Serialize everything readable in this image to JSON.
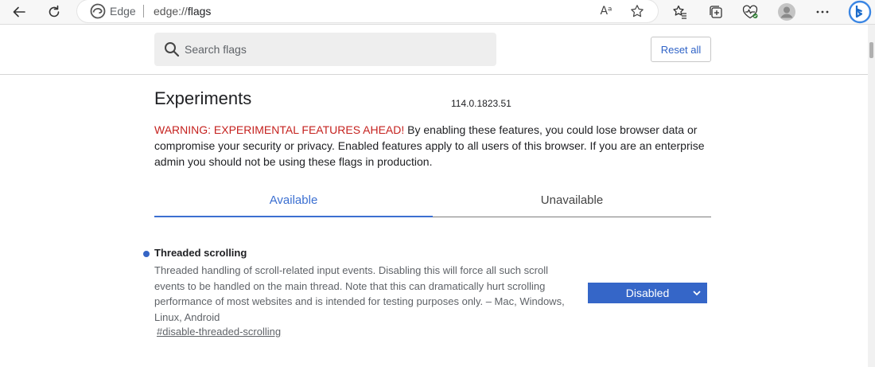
{
  "browser": {
    "edge_label": "Edge",
    "url_scheme": "edge://",
    "url_path": "flags",
    "read_aloud_glyph": "Aᵃ"
  },
  "header": {
    "search_placeholder": "Search flags",
    "reset_label": "Reset all"
  },
  "main": {
    "title": "Experiments",
    "version": "114.0.1823.51",
    "warning_label": "WARNING: EXPERIMENTAL FEATURES AHEAD!",
    "warning_text": " By enabling these features, you could lose browser data or compromise your security or privacy. Enabled features apply to all users of this browser. If you are an enterprise admin you should not be using these flags in production.",
    "tabs": [
      {
        "label": "Available",
        "active": true
      },
      {
        "label": "Unavailable",
        "active": false
      }
    ]
  },
  "experiments": [
    {
      "name": "Threaded scrolling",
      "description": "Threaded handling of scroll-related input events. Disabling this will force all such scroll events to be handled on the main thread. Note that this can dramatically hurt scrolling performance of most websites and is intended for testing purposes only. – Mac, Windows, Linux, Android",
      "link": "#disable-threaded-scrolling",
      "selected": "Disabled"
    }
  ],
  "colors": {
    "accent": "#3b6fd1",
    "warning": "#c5221f",
    "select_bg": "#3566c8",
    "indicator_dot": "#3565c5"
  },
  "icons": [
    "back-icon",
    "refresh-icon",
    "edge-logo-icon",
    "read-aloud-icon",
    "favorite-star-icon",
    "favorites-icon",
    "collections-icon",
    "browser-essentials-icon",
    "profile-icon",
    "more-icon",
    "bing-icon",
    "search-icon",
    "chevron-down-icon"
  ]
}
